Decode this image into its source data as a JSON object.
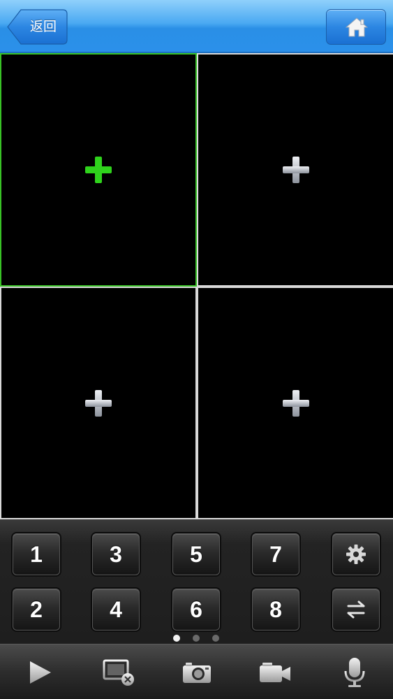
{
  "header": {
    "back_label": "返回",
    "home_icon": "home-icon"
  },
  "video_grid": {
    "selected_border_color": "#38c226",
    "cells": [
      {
        "icon": "add-icon",
        "selected": true
      },
      {
        "icon": "add-icon",
        "selected": false
      },
      {
        "icon": "add-icon",
        "selected": false
      },
      {
        "icon": "add-icon",
        "selected": false
      }
    ]
  },
  "channel_keys": {
    "row1": [
      "1",
      "3",
      "5",
      "7"
    ],
    "row2": [
      "2",
      "4",
      "6",
      "8"
    ],
    "side_icons": [
      "gear-icon",
      "switch-arrows-icon"
    ]
  },
  "pager": {
    "count": 3,
    "active": 0
  },
  "toolbar": {
    "icons": [
      "play-icon",
      "close-all-screen-icon",
      "camera-icon",
      "video-record-icon",
      "microphone-icon"
    ]
  },
  "colors": {
    "header_blue": "#2b90ea",
    "add_active": "#2fd31c",
    "add_inactive": "#c0c4cc"
  }
}
